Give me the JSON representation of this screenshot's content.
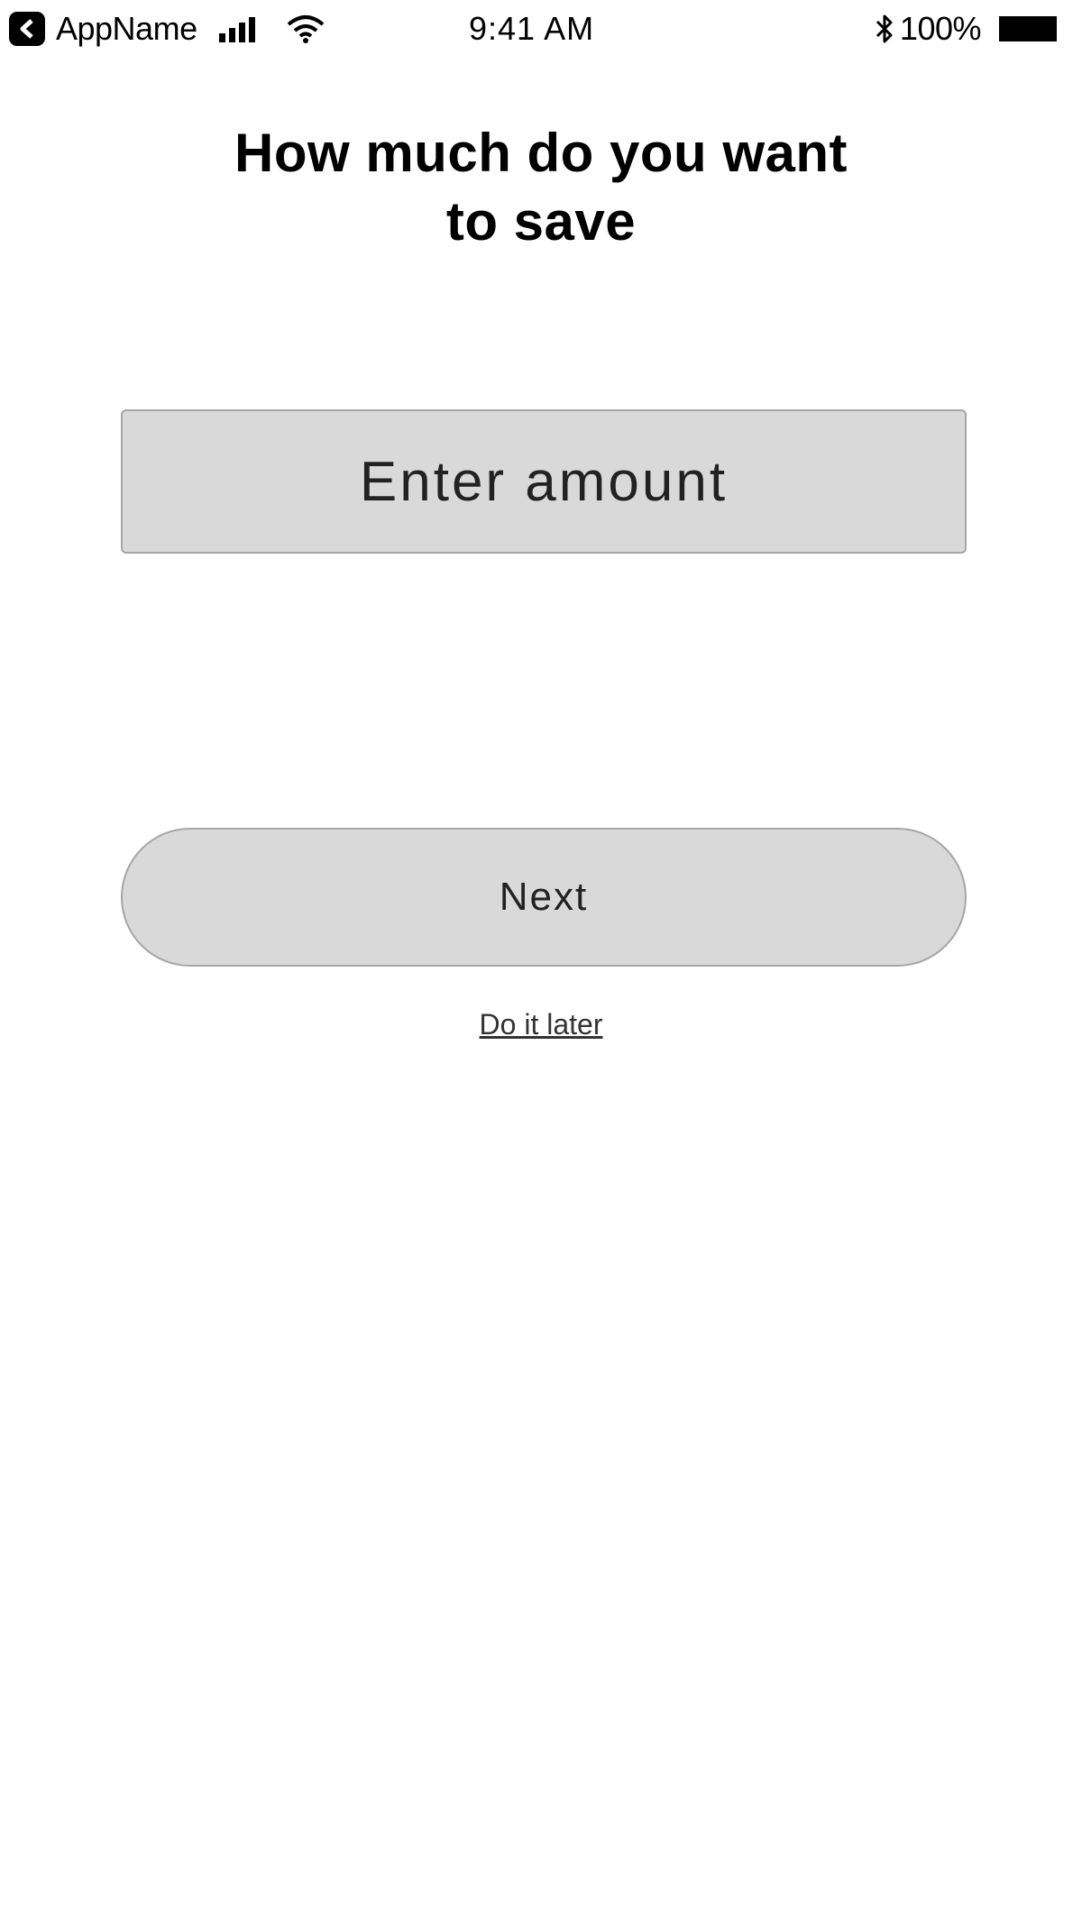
{
  "status_bar": {
    "app_name": "AppName",
    "time": "9:41 AM",
    "battery": "100%",
    "icons": {
      "back": "back-app-icon",
      "signal": "signal-icon",
      "wifi": "wifi-icon",
      "bluetooth": "bluetooth-icon",
      "battery": "battery-icon"
    }
  },
  "page": {
    "title_line1": "How much do you want",
    "title_line2": "to save"
  },
  "amount_input": {
    "value": "",
    "placeholder": "Enter amount"
  },
  "actions": {
    "next_label": "Next",
    "later_label": "Do it later"
  },
  "colors": {
    "control_fill": "#d9d9d9",
    "control_border": "#a6a6a6",
    "text": "#000000"
  }
}
